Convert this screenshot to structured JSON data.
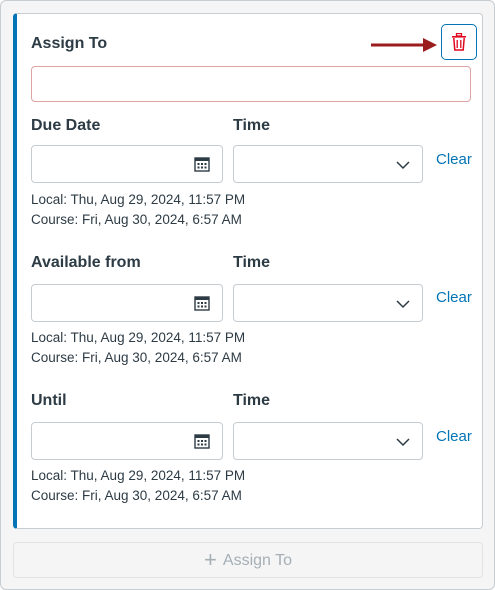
{
  "card": {
    "assign_to_label": "Assign To",
    "assign_to_value": "",
    "delete_icon": "trash-icon",
    "sections": [
      {
        "date_label": "Due Date",
        "time_label": "Time",
        "date_value": "",
        "time_value": "",
        "clear_label": "Clear",
        "local": "Local: Thu, Aug 29, 2024, 11:57 PM",
        "course": "Course: Fri, Aug 30, 2024, 6:57 AM"
      },
      {
        "date_label": "Available from",
        "time_label": "Time",
        "date_value": "",
        "time_value": "",
        "clear_label": "Clear",
        "local": "Local: Thu, Aug 29, 2024, 11:57 PM",
        "course": "Course: Fri, Aug 30, 2024, 6:57 AM"
      },
      {
        "date_label": "Until",
        "time_label": "Time",
        "date_value": "",
        "time_value": "",
        "clear_label": "Clear",
        "local": "Local: Thu, Aug 29, 2024, 11:57 PM",
        "course": "Course: Fri, Aug 30, 2024, 6:57 AM"
      }
    ]
  },
  "footer": {
    "assign_button_label": "Assign To",
    "plus_icon": "plus-icon"
  },
  "colors": {
    "accent": "#0374b5",
    "delete_red": "#e0061f",
    "annotation_arrow": "#9b1c1c",
    "error_border": "#e0a3a3"
  }
}
